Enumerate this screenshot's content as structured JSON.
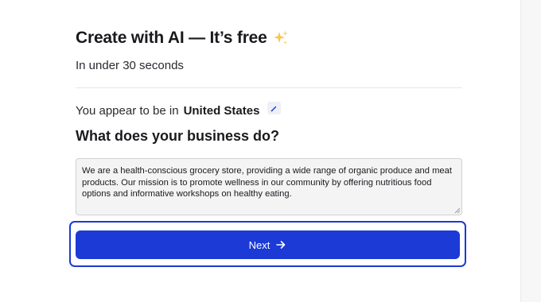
{
  "header": {
    "title": "Create with AI — It’s free",
    "title_icon": "sparkle-icon",
    "subtitle": "In under 30 seconds"
  },
  "location": {
    "prefix": "You appear to be in",
    "country": "United States",
    "edit_icon": "pencil-icon"
  },
  "business": {
    "question": "What does your business do?",
    "description": "We are a health-conscious grocery store, providing a wide range of organic produce and meat products. Our mission is to promote wellness in our community by offering nutritious food options and informative workshops on healthy eating."
  },
  "actions": {
    "next_label": "Next",
    "next_icon": "arrow-right-icon"
  },
  "colors": {
    "accent": "#1b3ad6",
    "sparkle": "#f5c84b",
    "textarea_bg": "#f4f4f5"
  }
}
